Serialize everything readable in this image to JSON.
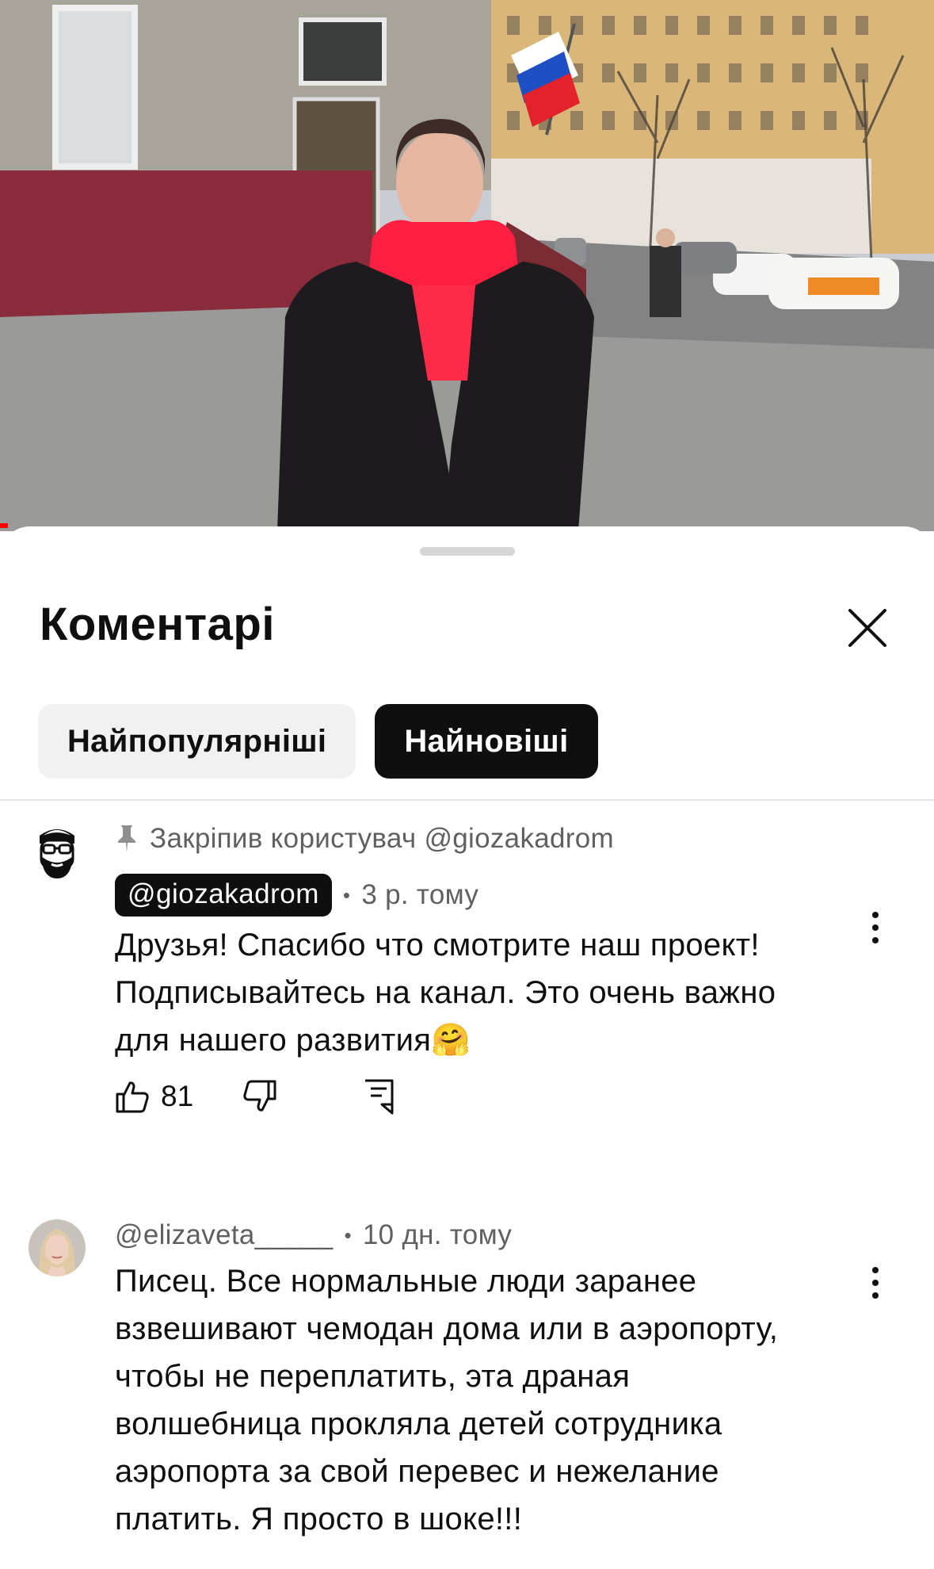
{
  "sheet": {
    "title": "Коментарі",
    "chips": [
      {
        "label": "Найпопулярніші",
        "selected": false
      },
      {
        "label": "Найновіші",
        "selected": true
      }
    ]
  },
  "comments": [
    {
      "pinned_text": "Закріпив користувач @giozakadrom",
      "author": "@giozakadrom",
      "time": "3 р. тому",
      "text": "Друзья! Спасибо что смотрите наш проект!\nПодписывайтесь на канал. Это очень важно\nдля нашего развития🤗",
      "likes": "81"
    },
    {
      "author": "@elizaveta_____",
      "time": "10 дн. тому",
      "text": "Писец. Все нормальные люди заранее\nвзвешивают чемодан дома или в аэропорту,\nчтобы не переплатить, эта драная\nволшебница прокляла детей сотрудника\nаэропорта за свой перевес и нежелание\nплатить. Я просто в шоке!!!"
    }
  ],
  "colors": {
    "accent": "#ff0000",
    "text_primary": "#0f0f0f",
    "text_secondary": "#606060",
    "chip_inactive": "#f1f1f1"
  }
}
